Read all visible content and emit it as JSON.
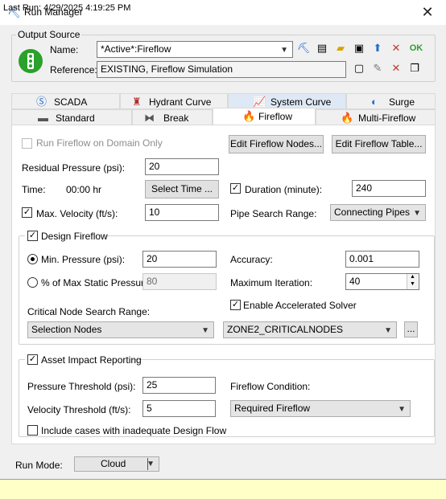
{
  "window": {
    "title": "Run Manager",
    "close_glyph": "✕"
  },
  "output_source": {
    "group_label": "Output Source",
    "name_label": "Name:",
    "name_value": "*Active*:Fireflow",
    "reference_label": "Reference:",
    "reference_value": "EXISTING, Fireflow Simulation",
    "toolbar_icons": [
      "run-icon",
      "report-icon",
      "open-folder-icon",
      "save-icon",
      "export-icon",
      "clear-icon",
      "ok-icon"
    ],
    "reference_icons": [
      "new-icon",
      "edit-icon",
      "delete-icon",
      "copy-icon"
    ],
    "ok_text": "OK"
  },
  "tabs": {
    "row1": [
      "SCADA",
      "Hydrant Curve",
      "System Curve",
      "Surge"
    ],
    "row2": [
      "Standard",
      "Break",
      "Fireflow",
      "Multi-Fireflow"
    ],
    "active": "Fireflow"
  },
  "fireflow": {
    "run_on_domain_only": "Run Fireflow on Domain Only",
    "edit_nodes_btn": "Edit Fireflow Nodes...",
    "edit_table_btn": "Edit Fireflow Table...",
    "residual_pressure_label": "Residual Pressure (psi):",
    "residual_pressure_value": "20",
    "time_label": "Time:",
    "time_value": "00:00 hr",
    "select_time_btn": "Select Time ...",
    "duration_label": "Duration (minute):",
    "duration_value": "240",
    "max_velocity_label": "Max. Velocity (ft/s):",
    "max_velocity_value": "10",
    "pipe_search_label": "Pipe Search Range:",
    "pipe_search_value": "Connecting Pipes"
  },
  "design": {
    "group_label": "Design Fireflow",
    "min_pressure_label": "Min. Pressure (psi):",
    "min_pressure_value": "20",
    "pct_static_label": "% of Max Static Pressure:",
    "pct_static_value": "80",
    "accuracy_label": "Accuracy:",
    "accuracy_value": "0.001",
    "max_iter_label": "Maximum Iteration:",
    "max_iter_value": "40",
    "accelerated_label": "Enable Accelerated Solver",
    "critical_label": "Critical Node Search Range:",
    "critical_value": "Selection Nodes",
    "selection_set_value": "ZONE2_CRITICALNODES",
    "ellipsis": "..."
  },
  "asset": {
    "group_label": "Asset Impact Reporting",
    "pressure_label": "Pressure Threshold (psi):",
    "pressure_value": "25",
    "velocity_label": "Velocity Threshold (ft/s):",
    "velocity_value": "5",
    "condition_label": "Fireflow Condition:",
    "condition_value": "Required Fireflow",
    "inadequate_label": "Include cases with inadequate Design Flow"
  },
  "run_mode": {
    "label": "Run Mode:",
    "value": "Cloud"
  },
  "status": {
    "last_run": "Last Run: 4/29/2025 4:19:25 PM"
  },
  "colors": {
    "accent": "#1c6fd1",
    "traffic_light": "#2aa12a",
    "status_bg": "#ffffc8",
    "fire": "#f07a00"
  }
}
